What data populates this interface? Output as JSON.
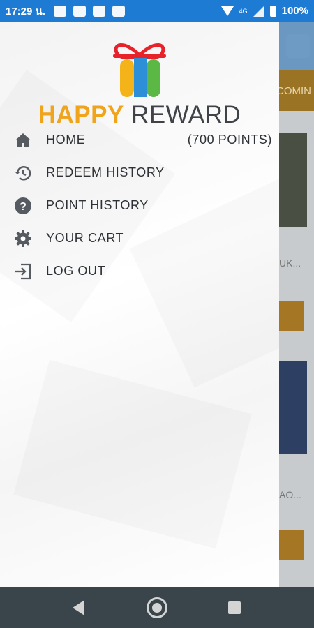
{
  "status_bar": {
    "time": "17:29 น.",
    "network": "4G",
    "battery": "100%"
  },
  "background": {
    "tab_text": "COMIN",
    "card1_text": "UK...",
    "card2_text": "AO..."
  },
  "drawer": {
    "logo": {
      "word1": "HAPPY",
      "word2": "REWARD"
    },
    "menu": [
      {
        "label": "HOME",
        "icon": "home-icon",
        "extra": "(700 POINTS)"
      },
      {
        "label": "REDEEM HISTORY",
        "icon": "history-icon"
      },
      {
        "label": "POINT HISTORY",
        "icon": "help-circle-icon"
      },
      {
        "label": "YOUR CART",
        "icon": "gear-icon"
      },
      {
        "label": "LOG OUT",
        "icon": "logout-icon"
      }
    ]
  },
  "colors": {
    "status_bar": "#1e7bd4",
    "brand_orange": "#f0a41b",
    "brand_dark": "#3f4347",
    "nav_bar": "#3a444b"
  }
}
